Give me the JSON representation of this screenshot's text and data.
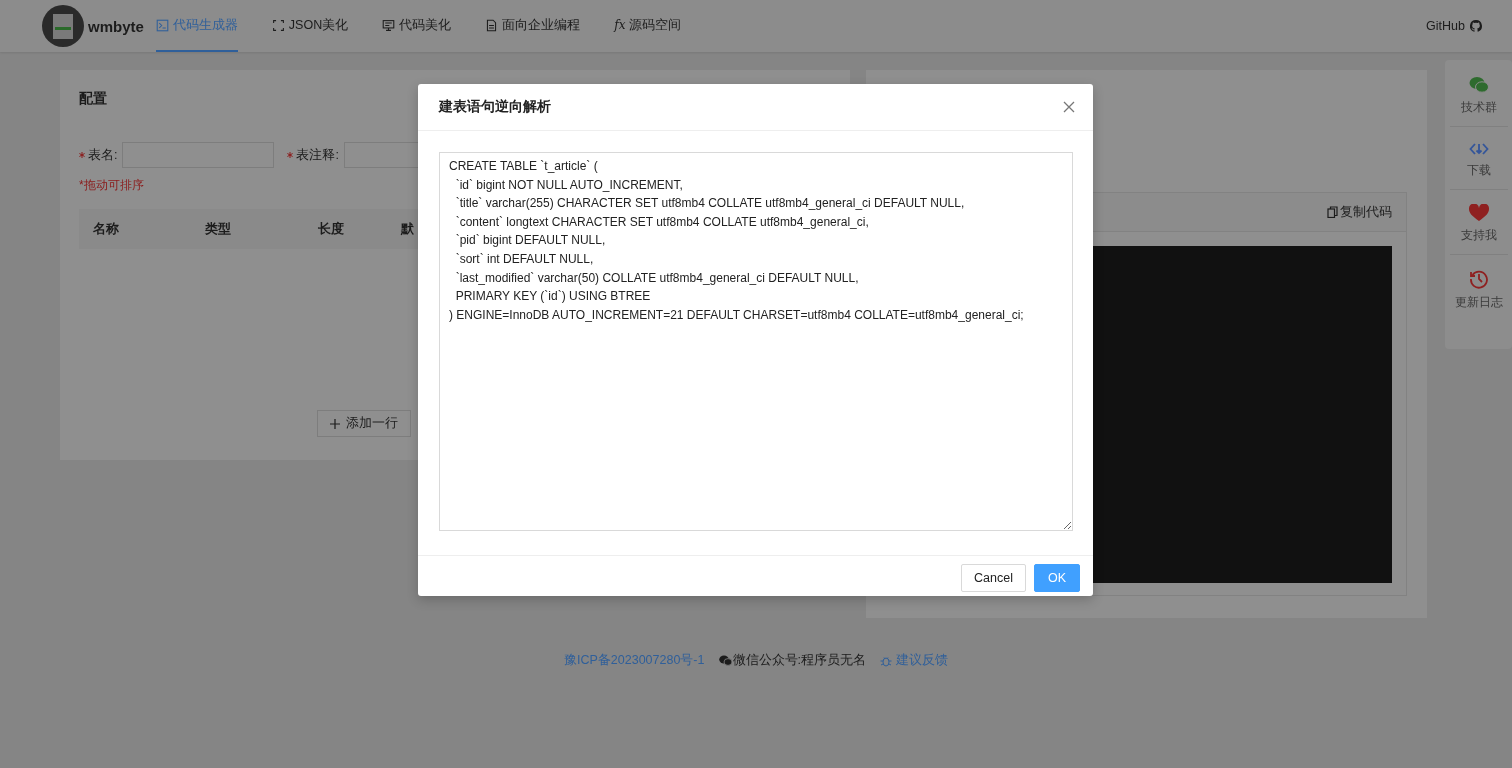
{
  "header": {
    "logo_text": "wmbyte",
    "nav": [
      {
        "label": "代码生成器",
        "kind": "terminal",
        "selected": true
      },
      {
        "label": "JSON美化",
        "kind": "brackets",
        "selected": false
      },
      {
        "label": "代码美化",
        "kind": "monitor",
        "selected": false
      },
      {
        "label": "面向企业编程",
        "kind": "document",
        "selected": false
      },
      {
        "label": "源码空间",
        "kind": "fx",
        "icon_text": "fx",
        "selected": false
      }
    ],
    "github": "GitHub"
  },
  "config_card": {
    "title": "配置",
    "fields": [
      {
        "label": "表名:",
        "required": true
      },
      {
        "label": "表注释:",
        "required": true
      }
    ],
    "hint": "*拖动可排序",
    "columns": [
      "名称",
      "类型",
      "长度",
      "默"
    ],
    "add_row_button": "添加一行"
  },
  "code_panel": {
    "copy_button": "复制代码"
  },
  "side_bar": [
    {
      "label": "技术群",
      "kind": "chat"
    },
    {
      "label": "下载",
      "kind": "download"
    },
    {
      "label": "支持我",
      "kind": "heart"
    },
    {
      "label": "更新日志",
      "kind": "history"
    }
  ],
  "footer": {
    "icp": "豫ICP备2023007280号-1",
    "wechat": "微信公众号:程序员无名",
    "feedback": "建议反馈"
  },
  "dialog": {
    "title": "建表语句逆向解析",
    "sql": [
      "CREATE TABLE `t_article` (",
      "  `id` bigint NOT NULL AUTO_INCREMENT,",
      "  `title` varchar(255) CHARACTER SET utf8mb4 COLLATE utf8mb4_general_ci DEFAULT NULL,",
      "  `content` longtext CHARACTER SET utf8mb4 COLLATE utf8mb4_general_ci,",
      "  `pid` bigint DEFAULT NULL,",
      "  `sort` int DEFAULT NULL,",
      "  `last_modified` varchar(50) COLLATE utf8mb4_general_ci DEFAULT NULL,",
      "  PRIMARY KEY (`id`) USING BTREE",
      ") ENGINE=InnoDB AUTO_INCREMENT=21 DEFAULT CHARSET=utf8mb4 COLLATE=utf8mb4_general_ci;"
    ],
    "buttons": [
      {
        "label": "Cancel",
        "kind": "default"
      },
      {
        "label": "OK",
        "kind": "primary"
      }
    ]
  }
}
